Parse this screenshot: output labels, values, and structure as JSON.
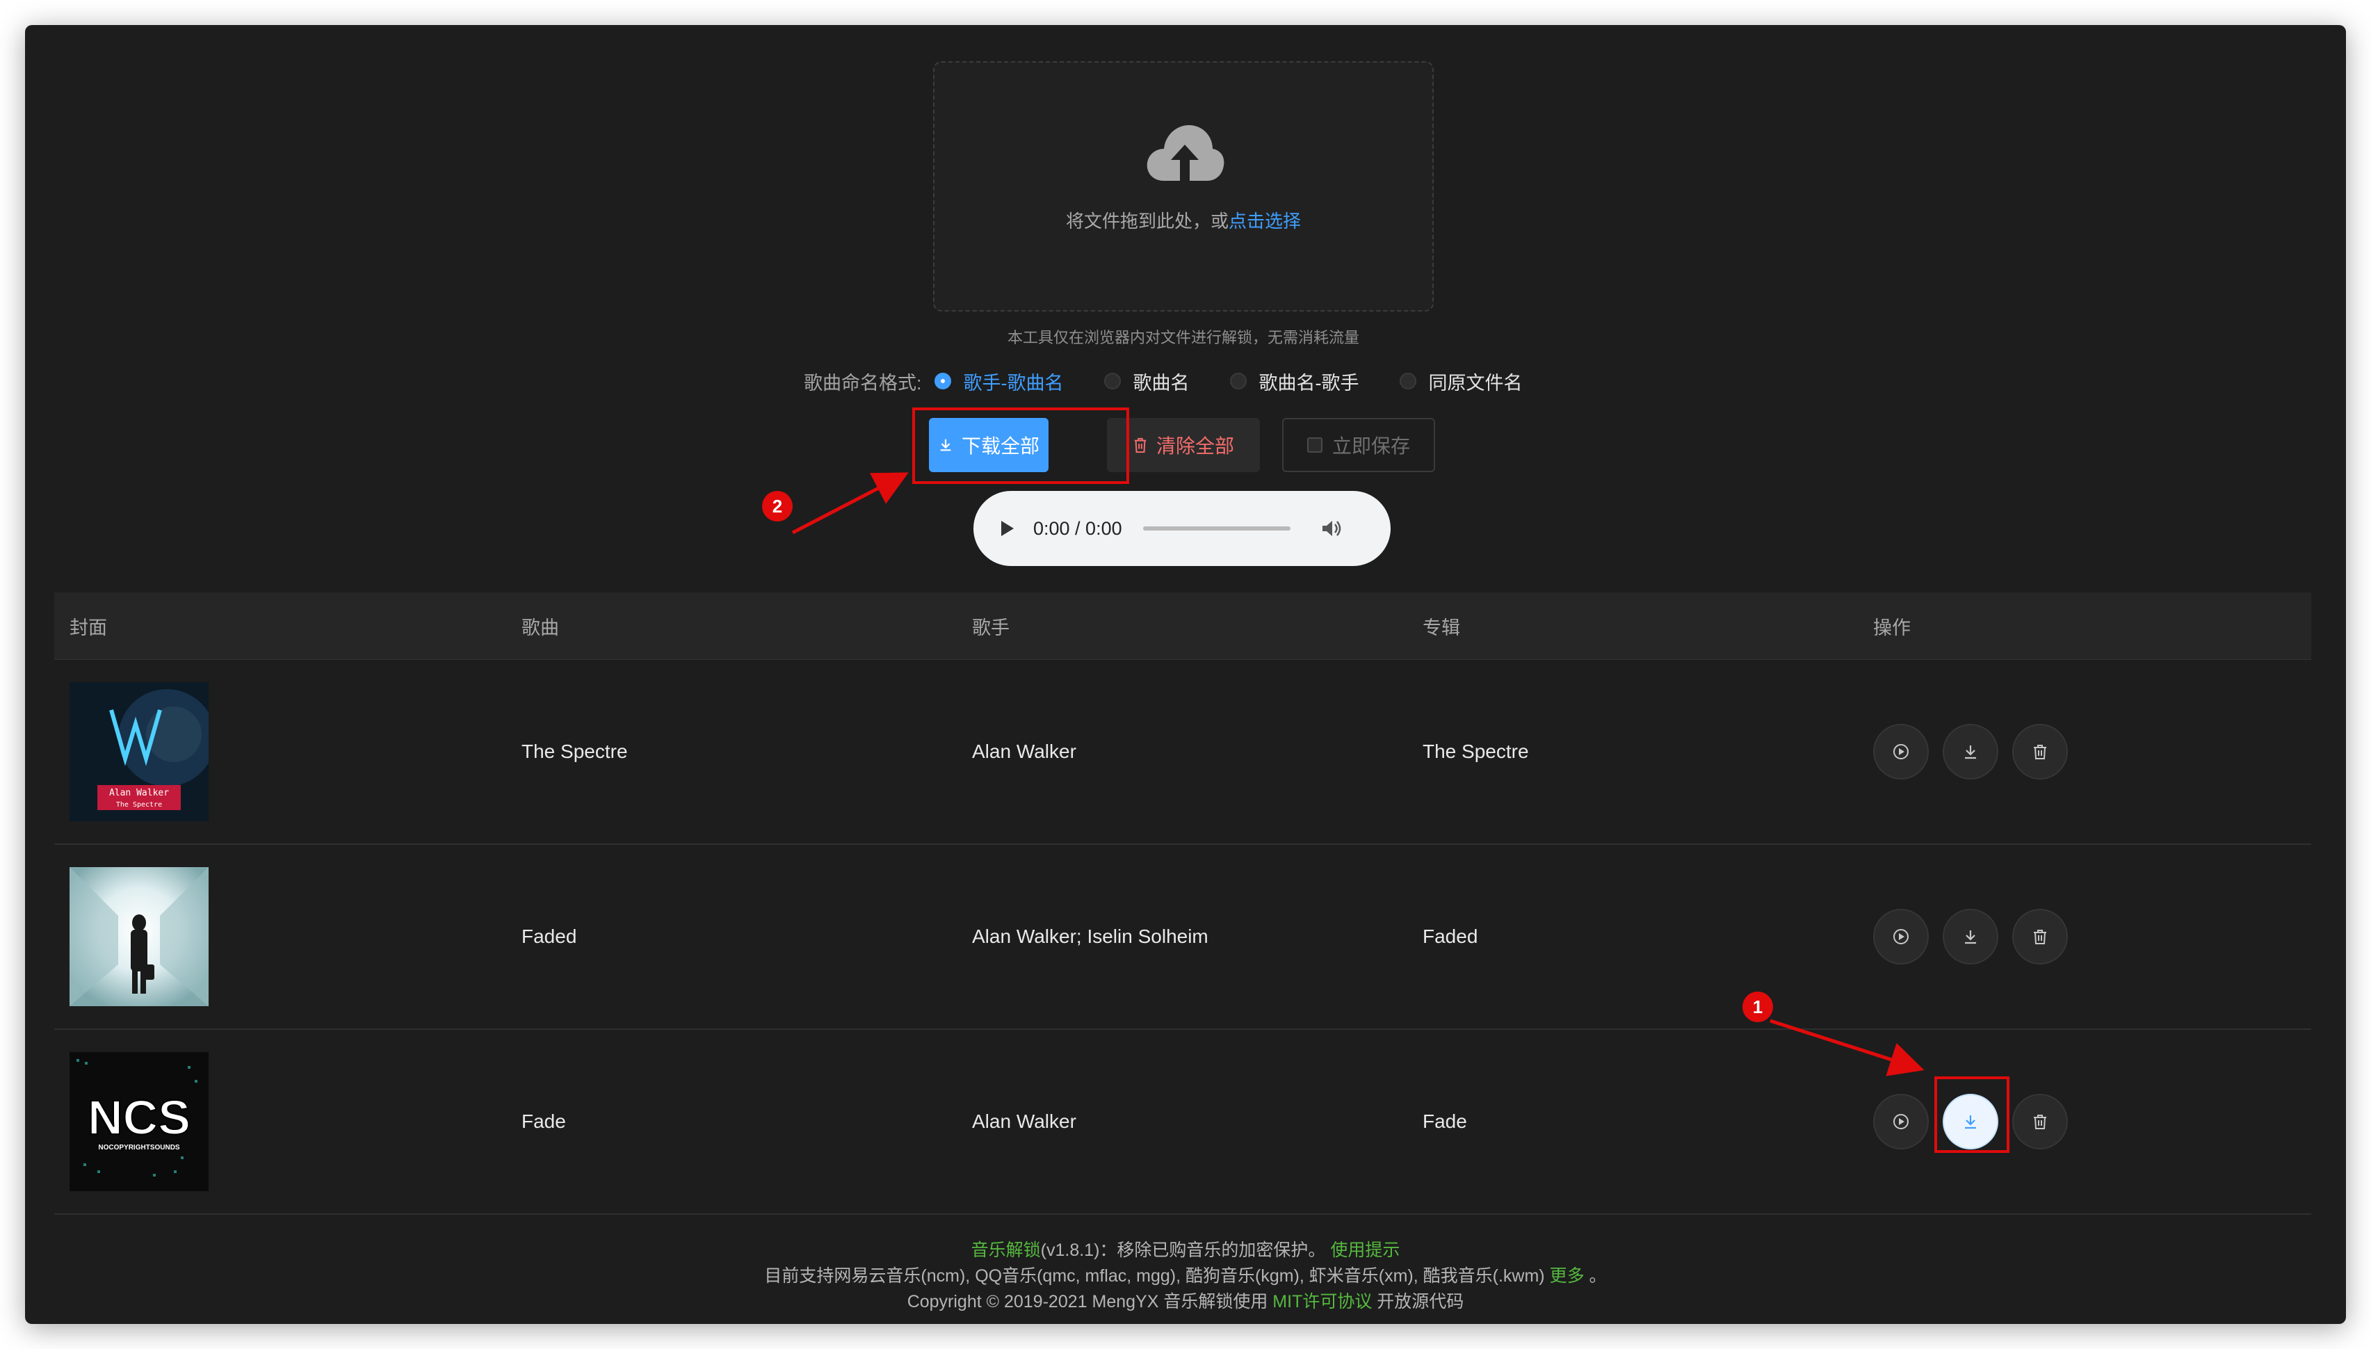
{
  "upload": {
    "hint_prefix": "将文件拖到此处，或",
    "hint_link": "点击选择",
    "tip": "本工具仅在浏览器内对文件进行解锁，无需消耗流量"
  },
  "naming": {
    "label": "歌曲命名格式:",
    "options": [
      {
        "label": "歌手-歌曲名",
        "checked": true
      },
      {
        "label": "歌曲名",
        "checked": false
      },
      {
        "label": "歌曲名-歌手",
        "checked": false
      },
      {
        "label": "同原文件名",
        "checked": false
      }
    ]
  },
  "actions": {
    "download_all": "下载全部",
    "clear_all": "清除全部",
    "save_now": "立即保存"
  },
  "player": {
    "time": "0:00 / 0:00"
  },
  "table": {
    "headers": {
      "cover": "封面",
      "song": "歌曲",
      "artist": "歌手",
      "album": "专辑",
      "ops": "操作"
    },
    "rows": [
      {
        "song": "The Spectre",
        "artist": "Alan Walker",
        "album": "The Spectre",
        "cover_text_1": "Alan Walker",
        "cover_text_2": "The Spectre"
      },
      {
        "song": "Faded",
        "artist": "Alan Walker; Iselin Solheim",
        "album": "Faded"
      },
      {
        "song": "Fade",
        "artist": "Alan Walker",
        "album": "Fade",
        "cover_text_1": "NCS",
        "cover_text_2": "NOCOPYRIGHTSOUNDS"
      }
    ]
  },
  "annotations": {
    "badge_1": "1",
    "badge_2": "2",
    "color": "#e10b0b"
  },
  "footer": {
    "line1_link": "音乐解锁",
    "line1_version": "(v1.8.1)：移除已购音乐的加密保护。",
    "line1_tips": "使用提示",
    "line2_text": "目前支持网易云音乐(ncm), QQ音乐(qmc, mflac, mgg), 酷狗音乐(kgm), 虾米音乐(xm), 酷我音乐(.kwm)",
    "line2_more": "更多",
    "line2_end": "。",
    "line3_text": "Copyright © 2019-2021 MengYX 音乐解锁使用",
    "line3_license": "MIT许可协议",
    "line3_source": "开放源代码"
  },
  "colors": {
    "accent": "#409eff",
    "danger": "#f56c6c",
    "footer_link": "#56b93f",
    "background": "#1d1d1d"
  }
}
